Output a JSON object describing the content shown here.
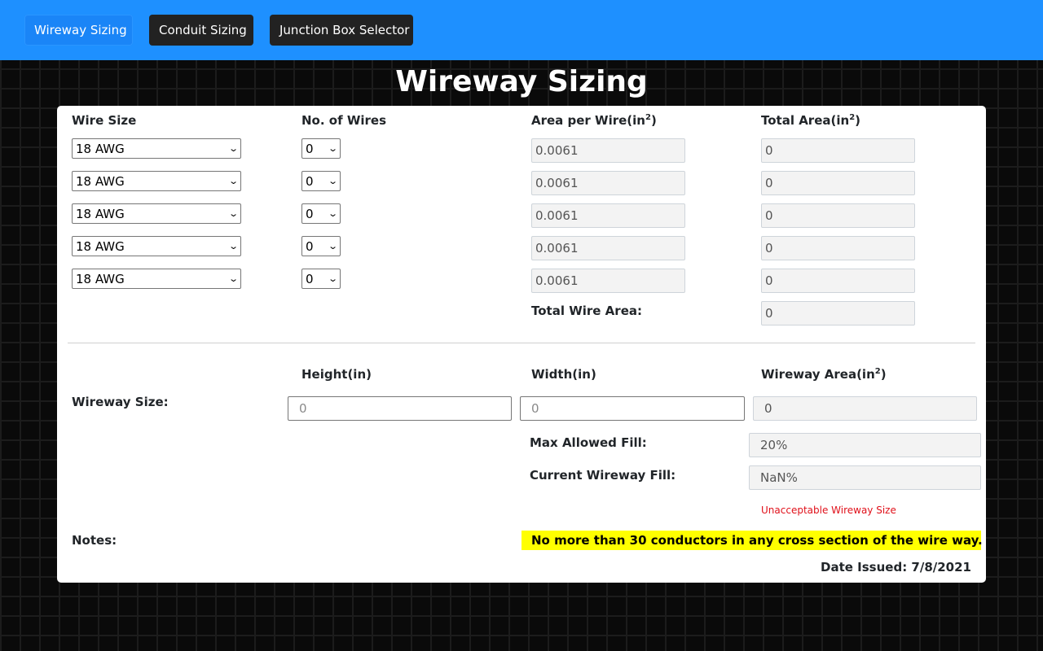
{
  "nav": {
    "items": [
      {
        "label": "Wireway Sizing",
        "active": true
      },
      {
        "label": "Conduit Sizing",
        "active": false
      },
      {
        "label": "Junction Box Selector",
        "active": false
      }
    ]
  },
  "page": {
    "title": "Wireway Sizing"
  },
  "wire_table": {
    "headers": {
      "wire_size": "Wire Size",
      "num_wires": "No. of Wires",
      "area_per_wire": "Area per Wire(in",
      "total_area": "Total Area(in",
      "superscript": "2",
      "close_paren": ")"
    },
    "rows": [
      {
        "wire_size": "18 AWG",
        "count": "0",
        "area_per_wire": "0.0061",
        "total_area": "0"
      },
      {
        "wire_size": "18 AWG",
        "count": "0",
        "area_per_wire": "0.0061",
        "total_area": "0"
      },
      {
        "wire_size": "18 AWG",
        "count": "0",
        "area_per_wire": "0.0061",
        "total_area": "0"
      },
      {
        "wire_size": "18 AWG",
        "count": "0",
        "area_per_wire": "0.0061",
        "total_area": "0"
      },
      {
        "wire_size": "18 AWG",
        "count": "0",
        "area_per_wire": "0.0061",
        "total_area": "0"
      }
    ],
    "total_wire_area_label": "Total Wire Area:",
    "total_wire_area_value": "0"
  },
  "wireway": {
    "label": "Wireway Size:",
    "height_label": "Height(in)",
    "width_label": "Width(in)",
    "area_label": "Wireway Area(in",
    "superscript": "2",
    "close_paren": ")",
    "height_placeholder": "0",
    "width_placeholder": "0",
    "area_value": "0",
    "max_fill_label": "Max Allowed Fill:",
    "max_fill_value": "20%",
    "current_fill_label": "Current Wireway Fill:",
    "current_fill_value": "NaN%",
    "warning": "Unacceptable Wireway Size"
  },
  "notes": {
    "label": "Notes:",
    "text": "No more than 30 conductors in any cross section of the wire way."
  },
  "footer": {
    "date_issued": "Date Issued: 7/8/2021"
  },
  "colors": {
    "navbar": "#1e90ff",
    "active_button": "#1a85f7",
    "inactive_button": "#222222",
    "warning": "#e0101a",
    "note_highlight": "#ffff00"
  },
  "icons": {
    "select_arrow": "chevron-down-icon"
  }
}
